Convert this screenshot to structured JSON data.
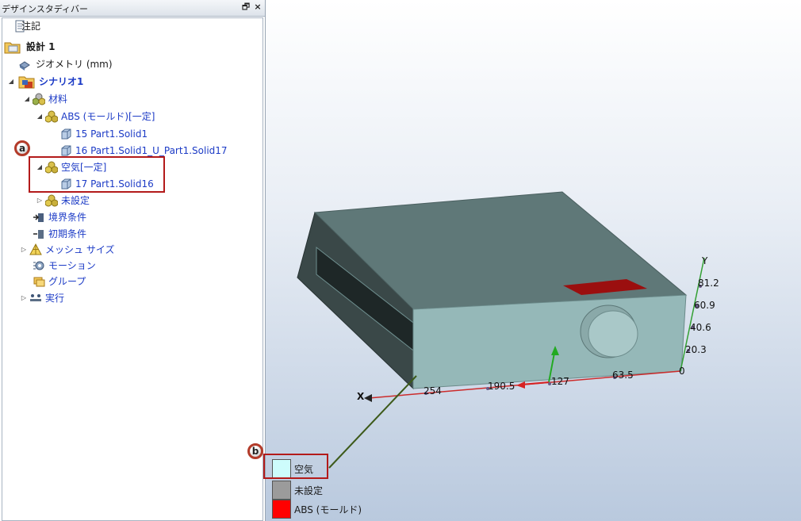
{
  "panel": {
    "title": "デザインスタディバー",
    "pin_glyph": "🗗",
    "close_glyph": "×"
  },
  "tree": {
    "notes": "注記",
    "design": "設計 1",
    "geometry": "ジオメトリ (mm)",
    "scenario": "シナリオ1",
    "materials": "材料",
    "abs_material": "ABS (モールド)[一定]",
    "part15": "15 Part1.Solid1",
    "part16": "16 Part1.Solid1_U_Part1.Solid17",
    "air_material": "空気[一定]",
    "part17": "17 Part1.Solid16",
    "unset": "未設定",
    "boundary": "境界条件",
    "initial": "初期条件",
    "mesh_size": "メッシュ サイズ",
    "motion": "モーション",
    "group": "グループ",
    "run": "実行",
    "expand_open": "◢",
    "expand_closed": "▷"
  },
  "callouts": {
    "a": "a",
    "b": "b"
  },
  "axes": {
    "x_label": "X",
    "y_label": "Y",
    "x_ticks": [
      "254",
      "190.5",
      "127",
      "63.5"
    ],
    "y_ticks": [
      "81.2",
      "60.9",
      "40.6",
      "20.3",
      "0"
    ]
  },
  "legend": [
    {
      "label": "空気",
      "color": "#cdfcfc"
    },
    {
      "label": "未設定",
      "color": "#9b9b9b"
    },
    {
      "label": "ABS (モールド)",
      "color": "#ff0000"
    }
  ]
}
